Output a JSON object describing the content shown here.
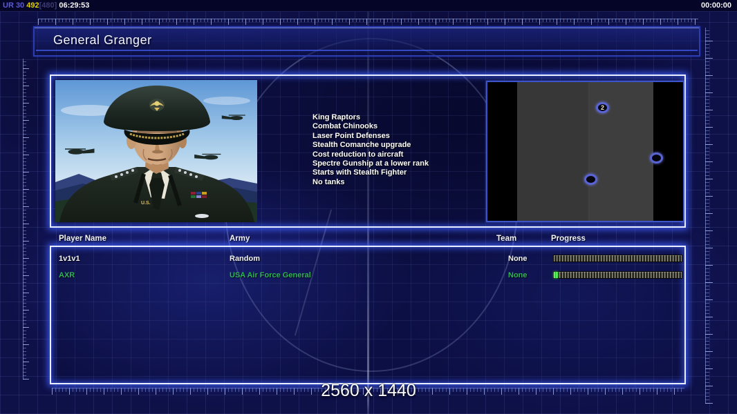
{
  "top_bar": {
    "connection_label": "UR 30 ",
    "fps_value": "492",
    "fps_cap": "[480]",
    "elapsed_time": " 06:29:53",
    "game_timer": "00:00:00"
  },
  "header": {
    "title": "General Granger"
  },
  "general_profile": {
    "abilities": [
      "King Raptors",
      "Combat Chinooks",
      "Laser Point Defenses",
      "Stealth Comanche upgrade",
      "Cost reduction to aircraft",
      "Spectre Gunship at a lower rank",
      "Starts with Stealth Fighter",
      "No tanks"
    ]
  },
  "portrait": {
    "pin_text": "U.S."
  },
  "minimap": {
    "start_spots": [
      {
        "label": "2"
      },
      {
        "label": ""
      },
      {
        "label": ""
      }
    ]
  },
  "player_table": {
    "columns": [
      "Player Name",
      "Army",
      "Team",
      "Progress"
    ],
    "rows": [
      {
        "name": "1v1v1",
        "army": "Random",
        "team": "None",
        "progress_percent": 0,
        "text_color": "#f2f2f2"
      },
      {
        "name": "AXR",
        "army": "USA Air Force General",
        "team": "None",
        "progress_percent": 3,
        "text_color": "#2fb457"
      }
    ]
  },
  "footer": {
    "resolution": "2560 x 1440"
  },
  "colors": {
    "accent_glow": "#4d6bff",
    "player_ready_green": "#2fb457",
    "progress_lead_green": "#3ed63e"
  }
}
